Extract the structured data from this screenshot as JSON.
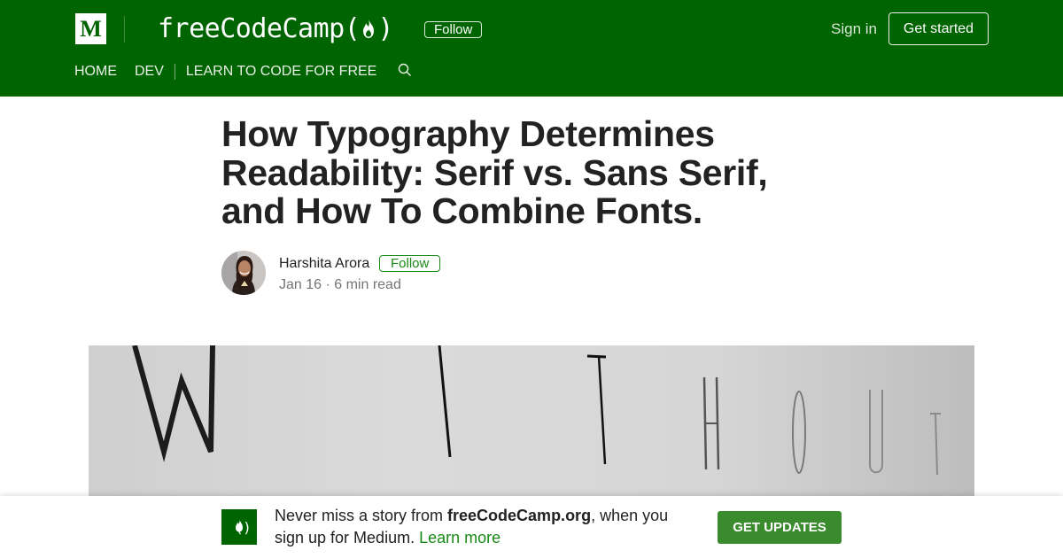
{
  "header": {
    "brand_letter": "M",
    "publication_name": "freeCodeCamp",
    "follow_label": "Follow",
    "signin_label": "Sign in",
    "get_started_label": "Get started",
    "background": "#006400"
  },
  "nav": {
    "items": [
      {
        "label": "HOME"
      },
      {
        "label": "DEV"
      },
      {
        "label": "LEARN TO CODE FOR FREE"
      }
    ],
    "search_icon": "search-icon"
  },
  "article": {
    "title_lines": [
      "How Typography Determines",
      "Readability: Serif vs. Sans Serif,",
      "and How To Combine Fonts."
    ],
    "author": "Harshita Arora",
    "follow_label": "Follow",
    "meta": "Jan 16 · 6 min read",
    "hero_word": "WITHOUT"
  },
  "banner": {
    "text_before": "Never miss a story from ",
    "publication": "freeCodeCamp.org",
    "text_after": ", when you sign up for Medium. ",
    "learn_more": "Learn more",
    "cta_label": "GET UPDATES"
  },
  "colors": {
    "brand_green": "#006400",
    "accent_green": "#1a8917",
    "cta_green": "#3a8a2e"
  }
}
